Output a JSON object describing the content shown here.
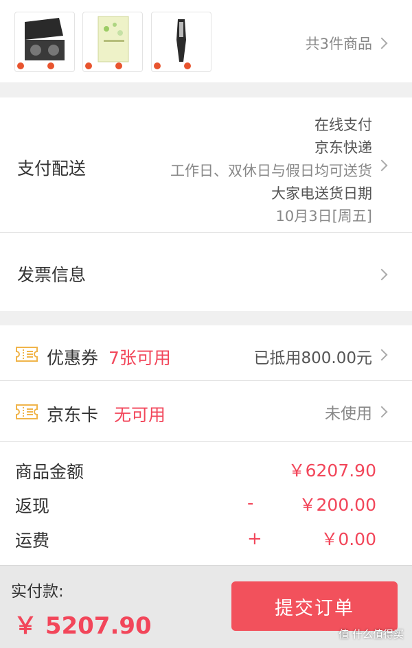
{
  "products": {
    "count_text": "共3件商品",
    "thumbnails": [
      {
        "icon": "range-hood-product"
      },
      {
        "icon": "boxed-product"
      },
      {
        "icon": "handheld-device-product"
      }
    ]
  },
  "payment": {
    "title": "支付配送",
    "method": "在线支付",
    "courier": "京东快递",
    "delivery_window": "工作日、双休日与假日均可送货",
    "appliance_note": "大家电送货日期",
    "date": "10月3日[周五]"
  },
  "invoice": {
    "title": "发票信息"
  },
  "coupon": {
    "title": "优惠券",
    "availability": "7张可用",
    "applied": "已抵用800.00元"
  },
  "jdcard": {
    "title": "京东卡",
    "availability": "无可用",
    "status": "未使用"
  },
  "amounts": {
    "goods_label": "商品金额",
    "goods_value": "￥6207.90",
    "cashback_label": "返现",
    "cashback_sign": "-",
    "cashback_value": "￥200.00",
    "shipping_label": "运费",
    "shipping_sign": "+",
    "shipping_value": "￥0.00"
  },
  "footer": {
    "total_label": "实付款:",
    "total_value": "￥ 5207.90",
    "submit_label": "提交订单"
  },
  "watermark": "值 什么值得买",
  "colors": {
    "accent_red": "#f2465a",
    "button_red": "#f2515c",
    "coupon_gold": "#f0b44a"
  }
}
